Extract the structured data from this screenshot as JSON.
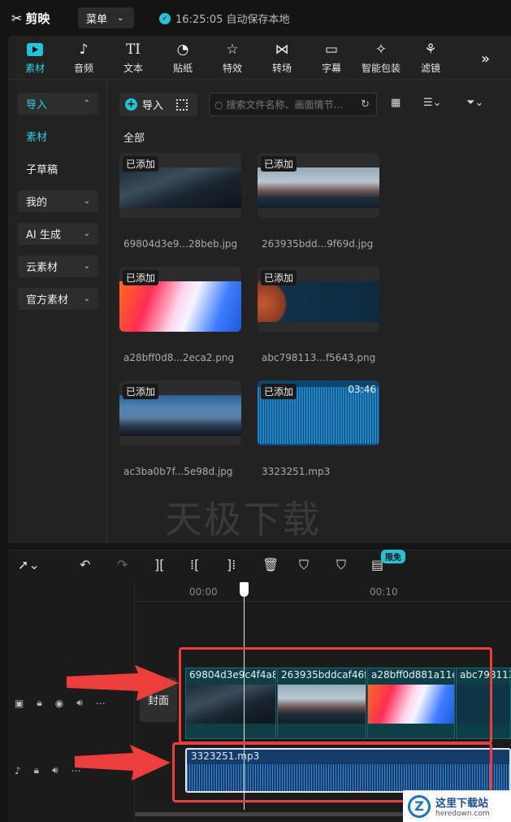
{
  "app": {
    "logo": "剪映",
    "menu_label": "菜单",
    "autosave": "16:25:05 自动保存本地"
  },
  "tools": [
    {
      "label": "素材",
      "icon": "media-icon"
    },
    {
      "label": "音频",
      "icon": "audio-icon"
    },
    {
      "label": "文本",
      "icon": "text-icon"
    },
    {
      "label": "贴纸",
      "icon": "sticker-icon"
    },
    {
      "label": "特效",
      "icon": "effects-icon"
    },
    {
      "label": "转场",
      "icon": "transition-icon"
    },
    {
      "label": "字幕",
      "icon": "subtitle-icon"
    },
    {
      "label": "智能包装",
      "icon": "smart-package-icon"
    },
    {
      "label": "滤镜",
      "icon": "filter-icon"
    }
  ],
  "sidebar": [
    {
      "label": "导入"
    },
    {
      "label": "素材"
    },
    {
      "label": "子草稿"
    },
    {
      "label": "我的"
    },
    {
      "label": "AI 生成"
    },
    {
      "label": "云素材"
    },
    {
      "label": "官方素材"
    }
  ],
  "content": {
    "import_label": "导入",
    "search_placeholder": "搜索文件名称、画面情节...",
    "section_all": "全部",
    "added_tag": "已添加",
    "files": [
      {
        "name": "69804d3e9...28beb.jpg"
      },
      {
        "name": "263935bdd...9f69d.jpg"
      },
      {
        "name": "a28bff0d8...2eca2.png"
      },
      {
        "name": "abc798113...f5643.png"
      },
      {
        "name": "ac3ba0b7f...5e98d.jpg"
      },
      {
        "name": "3323251.mp3",
        "duration": "03:46"
      }
    ],
    "watermark": "天极下载"
  },
  "timeline": {
    "free_badge": "限免",
    "ruler": [
      "00:00",
      "00:10"
    ],
    "cover_label": "封面",
    "video_clips": [
      "69804d3e9c4f4a8",
      "263935bddcaf46f",
      "a28bff0d881a11e",
      "abc798113"
    ],
    "audio_clip": "3323251.mp3"
  },
  "site_badge": {
    "title": "这里下载站",
    "url": "heredown.com"
  },
  "colors": {
    "accent": "#22c5d5",
    "annotation": "#ee3d3d"
  }
}
